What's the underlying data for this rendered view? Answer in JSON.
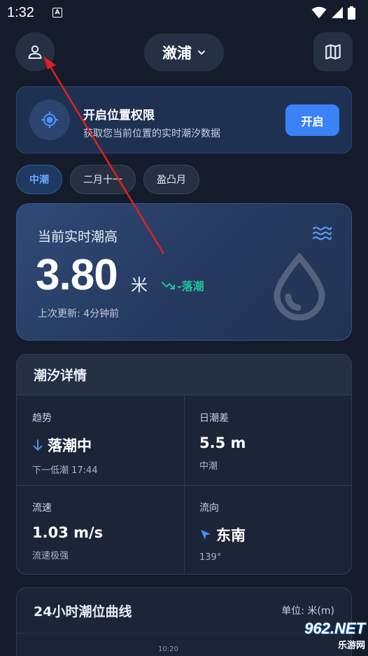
{
  "status_bar": {
    "time": "1:32",
    "notification_icon": "A"
  },
  "header": {
    "city": "漵浦"
  },
  "permission": {
    "title": "开启位置权限",
    "description": "获取您当前位置的实时潮汐数据",
    "button": "开启"
  },
  "chips": [
    "中潮",
    "二月十一",
    "盈凸月"
  ],
  "tide": {
    "label": "当前实时潮高",
    "value": "3.80",
    "unit": "米",
    "trend": "-落潮",
    "updated": "上次更新: 4分钟前"
  },
  "details": {
    "title": "潮汐详情",
    "items": [
      {
        "label": "趋势",
        "value": "落潮中",
        "sub": "下一低潮 17:44",
        "icon": "arrow-down-icon"
      },
      {
        "label": "日潮差",
        "value": "5.5 m",
        "sub": "中潮"
      },
      {
        "label": "流速",
        "value": "1.03 m/s",
        "sub": "流速极强"
      },
      {
        "label": "流向",
        "value": "东南",
        "sub": "139°",
        "icon": "navigation-arrow-icon"
      }
    ]
  },
  "curve": {
    "title": "24小时潮位曲线",
    "unit": "单位: 米(m)",
    "time_label": "10:20"
  },
  "watermark": {
    "top": "962.NET",
    "bottom": "乐游网"
  },
  "colors": {
    "accent": "#3b82f6",
    "trend_green": "#22c39a",
    "background": "#141c2c"
  }
}
